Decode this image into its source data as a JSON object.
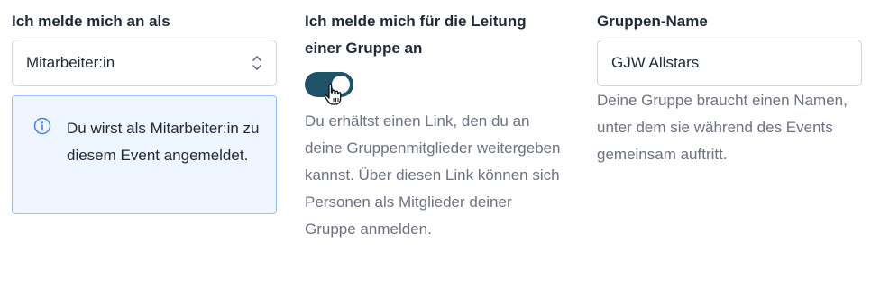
{
  "role_field": {
    "label": "Ich melde mich an als",
    "selected_value": "Mitarbeiter:in",
    "select_icon": "chevron-up-down-icon"
  },
  "info_box": {
    "icon": "info-circle-icon",
    "text": "Du wirst als Mitarbeiter:in zu diesem Event angemeldet.",
    "accent_color": "#3b82f6"
  },
  "leader_field": {
    "label": "Ich melde mich für die Leitung einer Gruppe an",
    "toggle_on": true,
    "toggle_color": "#1e5266",
    "help": "Du erhältst einen Link, den du an deine Gruppenmitglieder weitergeben kannst. Über diesen Link können sich Personen als Mitglieder deiner Gruppe anmelden."
  },
  "group_name_field": {
    "label": "Gruppen-Name",
    "value": "GJW Allstars",
    "help": "Deine Gruppe braucht einen Namen, unter dem sie während des Events gemeinsam auftritt."
  }
}
